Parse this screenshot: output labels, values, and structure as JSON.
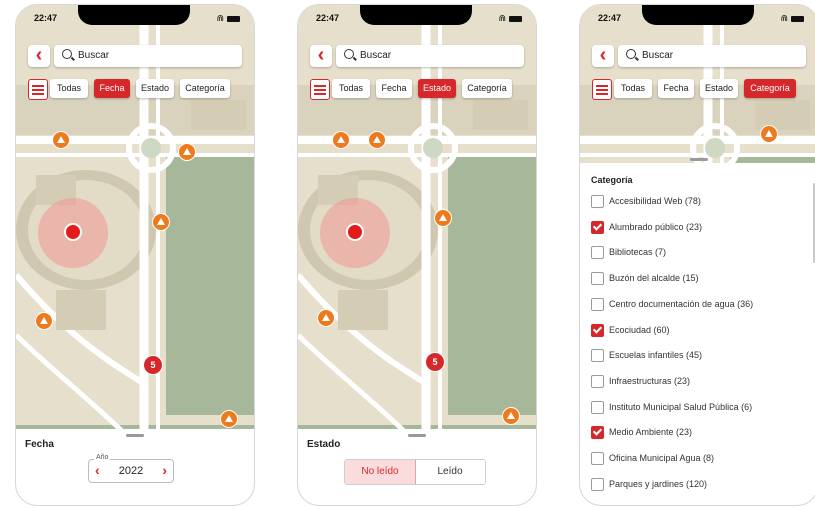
{
  "status_time": "22:47",
  "search": {
    "placeholder": "Buscar"
  },
  "filters": {
    "all": "Todas",
    "date": "Fecha",
    "state": "Estado",
    "category": "Categoría"
  },
  "active_filter_color": "#d6282b",
  "cluster_count": "5",
  "date_panel": {
    "title": "Fecha",
    "year_label": "Año",
    "year_value": "2022"
  },
  "state_panel": {
    "title": "Estado",
    "unread": "No leído",
    "read": "Leído",
    "selected": "No leído"
  },
  "category_panel": {
    "title": "Categoría",
    "items": [
      {
        "label": "Accesibilidad Web (78)",
        "checked": false
      },
      {
        "label": "Alumbrado público (23)",
        "checked": true
      },
      {
        "label": "Bibliotecas (7)",
        "checked": false
      },
      {
        "label": "Buzón del alcalde (15)",
        "checked": false
      },
      {
        "label": "Centro documentación de agua (36)",
        "checked": false
      },
      {
        "label": "Ecociudad (60)",
        "checked": true
      },
      {
        "label": "Escuelas infantiles (45)",
        "checked": false
      },
      {
        "label": "Infraestructuras (23)",
        "checked": false
      },
      {
        "label": "Instituto Municipal Salud Pública (6)",
        "checked": false
      },
      {
        "label": "Medio Ambiente (23)",
        "checked": true
      },
      {
        "label": "Oficina Municipal Agua (8)",
        "checked": false
      },
      {
        "label": "Parques y jardines (120)",
        "checked": false
      }
    ]
  }
}
